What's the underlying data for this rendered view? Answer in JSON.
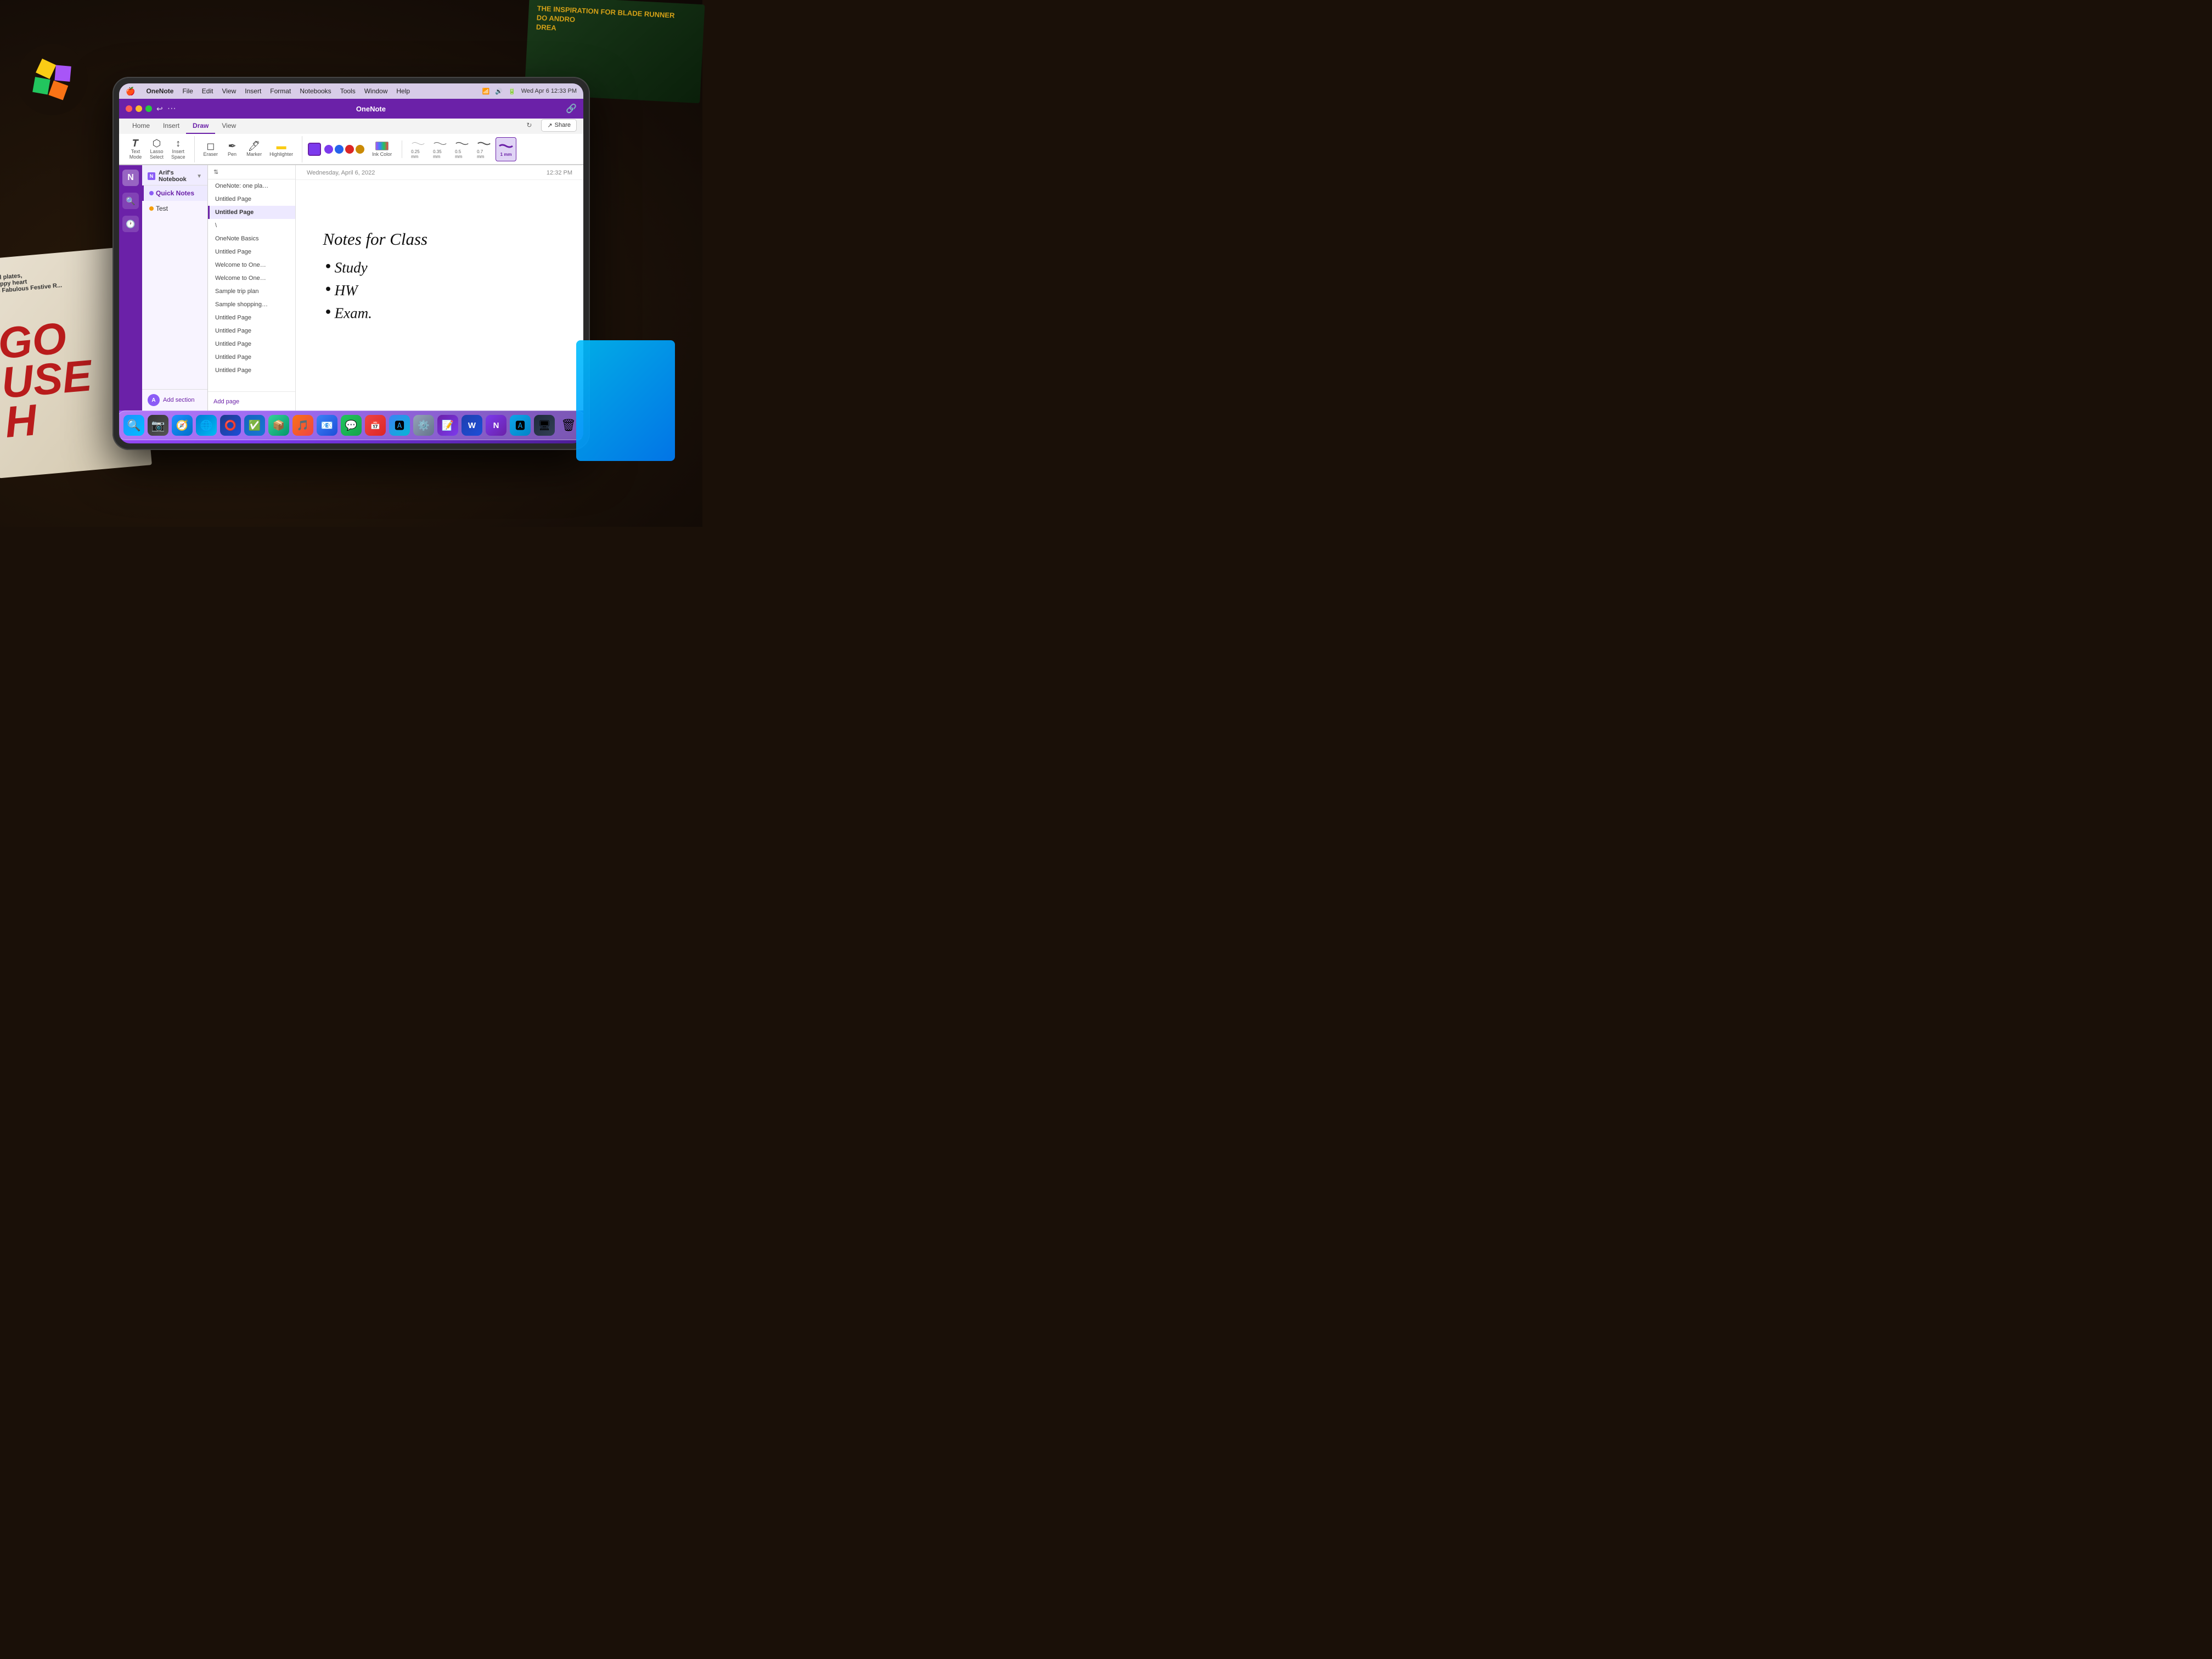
{
  "app": {
    "title": "OneNote",
    "window_title": "OneNote"
  },
  "macos": {
    "apple_symbol": "",
    "app_name": "OneNote",
    "menus": [
      "OneNote",
      "File",
      "Edit",
      "View",
      "Insert",
      "Format",
      "Notebooks",
      "Tools",
      "Window",
      "Help"
    ],
    "right_status": "Wed Apr 6  12:33 PM"
  },
  "ribbon": {
    "tabs": [
      {
        "label": "Home",
        "active": false
      },
      {
        "label": "Insert",
        "active": false
      },
      {
        "label": "Draw",
        "active": true
      },
      {
        "label": "View",
        "active": false
      }
    ],
    "tools": [
      {
        "label": "Text\nMode",
        "icon": "T"
      },
      {
        "label": "Lasso\nSelect",
        "icon": "⬡"
      },
      {
        "label": "Insert\nSpace",
        "icon": "↕"
      }
    ],
    "eraser_label": "Eraser",
    "pen_label": "Pen",
    "marker_label": "Marker",
    "highlighter_label": "Highlighter",
    "ink_color_label": "Ink\nColor",
    "stroke_sizes": [
      "0.25 mm",
      "0.35 mm",
      "0.5 mm",
      "0.7 mm",
      "1 mm"
    ],
    "active_stroke": 4,
    "colors": [
      "#7c3aed",
      "#2563eb",
      "#dc2626",
      "#ca8a04"
    ]
  },
  "notebook": {
    "name": "Arif's Notebook",
    "sections": [
      {
        "label": "Quick Notes",
        "color": "#8b5cf6",
        "active": true
      },
      {
        "label": "Test",
        "color": "#f59e0b",
        "active": false
      }
    ]
  },
  "pages": {
    "list": [
      {
        "label": "OneNote: one pla…",
        "active": false
      },
      {
        "label": "Untitled Page",
        "active": false
      },
      {
        "label": "Untitled Page",
        "active": true
      },
      {
        "label": "\\",
        "active": false
      },
      {
        "label": "OneNote Basics",
        "active": false
      },
      {
        "label": "Untitled Page",
        "active": false
      },
      {
        "label": "Welcome to One…",
        "active": false
      },
      {
        "label": "Welcome to One…",
        "active": false
      },
      {
        "label": "Sample trip plan",
        "active": false
      },
      {
        "label": "Sample shopping…",
        "active": false
      },
      {
        "label": "Untitled Page",
        "active": false
      },
      {
        "label": "Untitled Page",
        "active": false
      },
      {
        "label": "Untitled Page",
        "active": false
      },
      {
        "label": "Untitled Page",
        "active": false
      },
      {
        "label": "Untitled Page",
        "active": false
      }
    ],
    "add_section_label": "Add section",
    "add_page_label": "Add page"
  },
  "note": {
    "date": "Wednesday, April 6, 2022",
    "time": "12:32 PM",
    "title": "Notes for Class",
    "content_lines": [
      "• Study",
      "• HW",
      "• Exam."
    ]
  },
  "share": {
    "label": "Share"
  },
  "dock": {
    "icons": [
      "🔍",
      "📷",
      "🌐",
      "🦊",
      "⭕",
      "✅",
      "🔧",
      "📦",
      "🎵",
      "📧",
      "💬",
      "📅",
      "🅰",
      "⚙️",
      "🎮",
      "📝",
      "🔷",
      "🅰",
      "🗑"
    ]
  }
}
